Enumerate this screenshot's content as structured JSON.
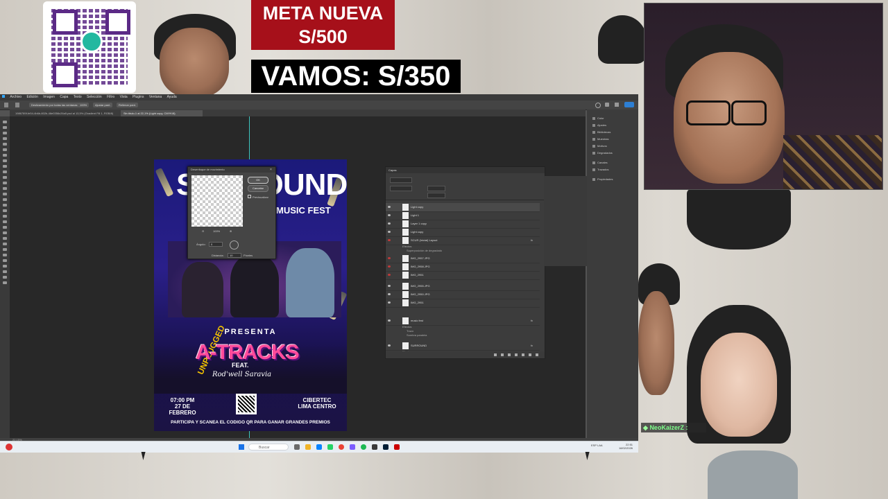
{
  "overlay": {
    "goal_title": "META NUEVA",
    "goal_amount": "S/500",
    "progress_text": "VAMOS: S/350",
    "chat_user": "NeoKaizerZ :",
    "qr_brand": "yape"
  },
  "photoshop": {
    "menu": [
      "Archivo",
      "Edición",
      "Imagen",
      "Capa",
      "Texto",
      "Selección",
      "Filtro",
      "Vista",
      "Plugins",
      "Ventana",
      "Ayuda"
    ],
    "options": [
      "Deslizamiento por todas las ventanas",
      "100%",
      "Ajustar pant.",
      "Rellenar pant."
    ],
    "tabs": [
      {
        "label": "1986789f-fe54-4b6b-802b-46e0356c26a5.psd al 13,5% (Gradient Fill 1, RGB/8)",
        "active": false
      },
      {
        "label": "Sin título-1 al 22,1% (Light copy, CMYK/8)",
        "active": true
      }
    ],
    "status": "22,15%",
    "right_dock": [
      "Color",
      "Ajustes",
      "Bibliotecas",
      "Muestras",
      "Motivos",
      "Degradados",
      "Canales",
      "Trazados",
      "Propiedades"
    ]
  },
  "dialog": {
    "title": "Desenfoque de movimiento",
    "ok": "OK",
    "cancel": "Cancelar",
    "preview_label": "Previsualizar",
    "zoom": "100%",
    "angle_label": "Ángulo:",
    "angle_value": "0",
    "distance_label": "Distancia:",
    "distance_value": "10",
    "distance_unit": "Píxeles"
  },
  "layers_panel": {
    "title": "Capas",
    "rows": [
      {
        "name": "Light copy",
        "sel": true
      },
      {
        "name": "Light 1",
        "sel": false
      },
      {
        "name": "Layer 1 copy",
        "sel": false
      },
      {
        "name": "Light copy",
        "sel": false
      },
      {
        "name": "SCUR (Inicial) Layout",
        "sel": false
      },
      {
        "name": "IMG_2957.JPG",
        "sel": false
      },
      {
        "name": "IMG_2958.JPG",
        "sel": false
      },
      {
        "name": "IMG_2951",
        "sel": false
      },
      {
        "name": "IMG_2955.JPG",
        "sel": false
      },
      {
        "name": "IMG_2950.JPG",
        "sel": false
      },
      {
        "name": "IMG_2951",
        "sel": false
      },
      {
        "name": "music fest",
        "sel": false
      },
      {
        "name": "SURROUND",
        "sel": false
      }
    ],
    "subs": [
      "Efectos",
      "Superposición de degradado",
      "Efectos",
      "Trazo",
      "Sombra paralela",
      "Efectos"
    ]
  },
  "poster": {
    "title": "SURROUND",
    "subtitle": "MUSIC FEST",
    "presents": "PRESENTA",
    "unplugged": "UNPLUGGED",
    "headliner": "A-TRACKS",
    "feat": "FEAT.",
    "guest": "Rod'well Saravia",
    "time": "07:00 PM",
    "date": "27 DE FEBRERO",
    "venue1": "CIBERTEC",
    "venue2": "LIMA CENTRO",
    "footer": "PARTICIPA Y SCANEA EL CODIGO QR PARA GANAR GRANDES PREMIOS"
  },
  "taskbar": {
    "search_placeholder": "Buscar",
    "time": "22:51",
    "date": "18/02/2026",
    "lang": "ESP LAA"
  }
}
